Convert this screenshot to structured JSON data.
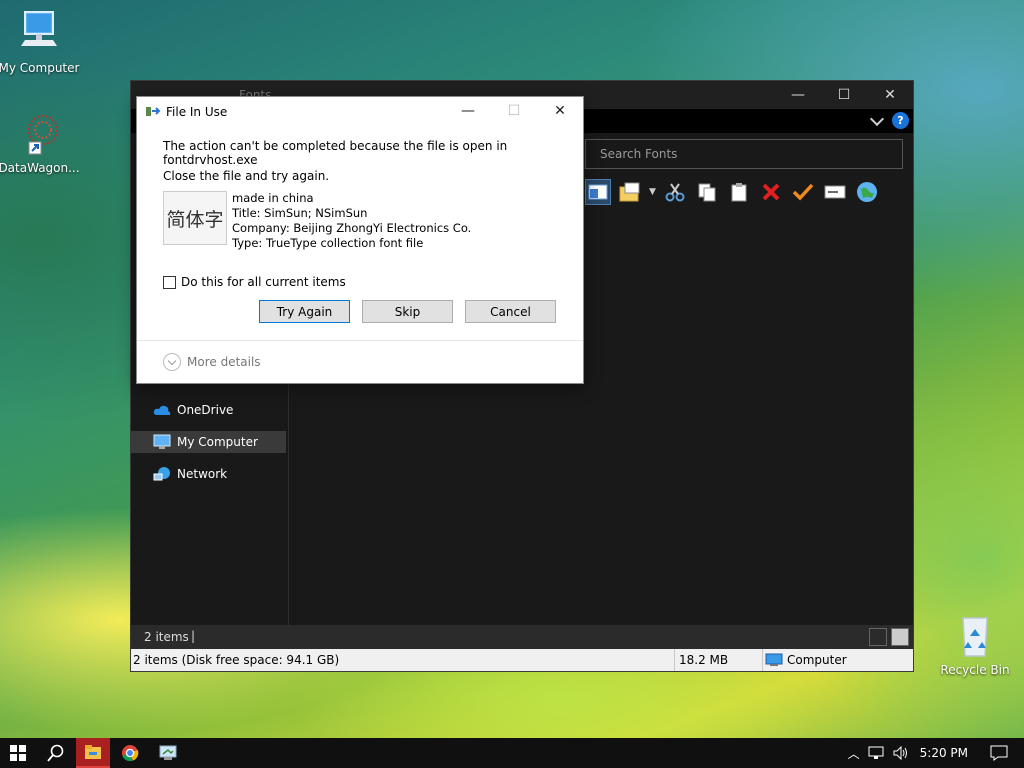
{
  "desktop": {
    "icons": [
      {
        "label": "My Computer"
      },
      {
        "label": "DataWagon..."
      },
      {
        "label": "Recycle Bin"
      }
    ]
  },
  "explorer": {
    "title": "Fonts",
    "search_placeholder": "Search Fonts",
    "help_label": "?",
    "nav": [
      {
        "label": "OneDrive"
      },
      {
        "label": "My Computer"
      },
      {
        "label": "Network"
      }
    ],
    "status": {
      "count": "2 items",
      "cursor": "|"
    },
    "bottombar": {
      "summary": "2 items (Disk free space: 94.1 GB)",
      "size": "18.2 MB",
      "location": "Computer"
    }
  },
  "dialog": {
    "title": "File In Use",
    "message": "The action can't be completed because the file is open in fontdrvhost.exe",
    "sub": "Close the file and try again.",
    "thumbnail_text": "简体字",
    "file": {
      "line1": "made in china",
      "line2": "Title: SimSun; NSimSun",
      "line3": "Company: Beijing ZhongYi Electronics Co.",
      "line4": "Type: TrueType collection font file"
    },
    "checkbox_label": "Do this for all current items",
    "buttons": {
      "try_again": "Try Again",
      "skip": "Skip",
      "cancel": "Cancel"
    },
    "more_details": "More details"
  },
  "taskbar": {
    "clock": "5:20 PM"
  },
  "colors": {
    "explorer_bg": "#191919",
    "accent": "#0078d7",
    "taskbar_active": "#a82020"
  }
}
